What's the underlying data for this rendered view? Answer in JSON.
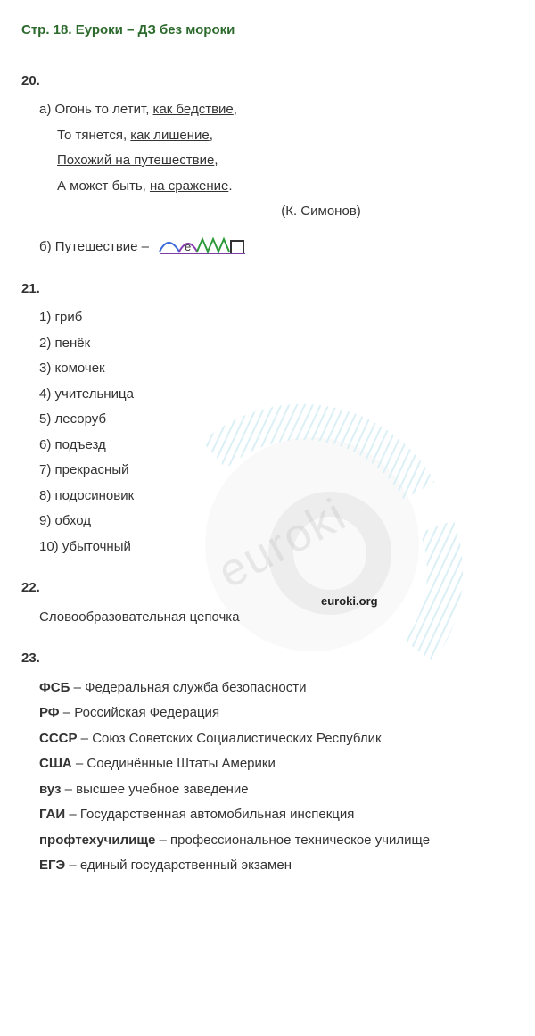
{
  "title": "Стр. 18. Еуроки – ДЗ без мороки",
  "watermark_label": "euroki.org",
  "watermark_text": "euroki",
  "ex20": {
    "num": "20.",
    "a_label": "а) ",
    "line1_pre": "Огонь то летит, ",
    "line1_u": "как бедствие",
    "line2_pre": "То тянется, ",
    "line2_u": "как лишение",
    "line3_u": "Похожий на путешествие",
    "line4_pre": "А может быть, ",
    "line4_u": "на сражение",
    "author": "(К. Симонов)",
    "b_label": "б) Путешествие – ",
    "morph_letter": "е"
  },
  "ex21": {
    "num": "21.",
    "items": [
      "1) гриб",
      "2) пенёк",
      "3) комочек",
      "4) учительница",
      "5) лесоруб",
      "6) подъезд",
      "7) прекрасный",
      "8) подосиновик",
      "9) обход",
      "10) убыточный"
    ]
  },
  "ex22": {
    "num": "22.",
    "text": "Словообразовательная цепочка"
  },
  "ex23": {
    "num": "23.",
    "items": [
      {
        "abbr": "ФСБ",
        "full": " – Федеральная служба безопасности"
      },
      {
        "abbr": "РФ",
        "full": " – Российская Федерация"
      },
      {
        "abbr": "СССР",
        "full": " – Союз Советских Социалистических Республик"
      },
      {
        "abbr": "США",
        "full": " – Соединённые Штаты Америки"
      },
      {
        "abbr": "вуз",
        "full": " – высшее учебное заведение"
      },
      {
        "abbr": "ГАИ",
        "full": " – Государственная автомобильная инспекция"
      },
      {
        "abbr": "профтехучилище",
        "full": " – профессиональное техническое училище"
      },
      {
        "abbr": "ЕГЭ",
        "full": " – единый государственный экзамен"
      }
    ]
  }
}
